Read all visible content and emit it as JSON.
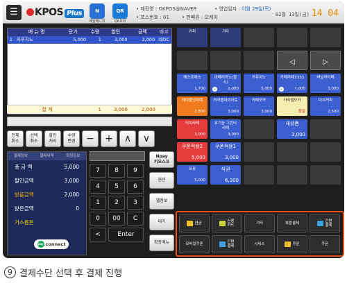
{
  "topbar": {
    "menu_icon": "hamburger-icon",
    "logo_main": "KPOS",
    "logo_plus": "Plus",
    "icon1_label": "배달메니저",
    "icon1_text": "N",
    "icon2_label": "QR오더",
    "icon2_text": "QR",
    "store_label": "• 매장명 : OKPOS@NAVER",
    "pos_label": "• 포스번호 : 01",
    "business_date_label": "• 영업일자 : ",
    "business_date": "이월 29일(목)",
    "cashier_label": "• 판매원 : 오케이",
    "date_label": "02월 13일(금)",
    "time": "14 04"
  },
  "order_table": {
    "headers": [
      "",
      "메 뉴 명",
      "단가",
      "수량",
      "할인",
      "금액",
      "비고"
    ],
    "rows": [
      [
        "1",
        "카푸치노",
        "5,000",
        "1",
        "3,000",
        "2,000",
        "네OC"
      ]
    ],
    "sum_label": "합    계",
    "sum_qty": "1",
    "sum_discount": "3,000",
    "sum_amount": "2,000"
  },
  "action_buttons": [
    {
      "label": "전체\n취소"
    },
    {
      "label": "선택\n취소"
    },
    {
      "label": "할인\n처리"
    },
    {
      "label": "수량\n변경"
    }
  ],
  "arrow_buttons": [
    "−",
    "+",
    "∧",
    "∨"
  ],
  "payment_info": {
    "tabs": [
      "결제정보",
      "결제내역",
      "회원정보"
    ],
    "total_label": "총 금 액",
    "total_value": "5,000",
    "discount_label": "할인금액",
    "discount_value": "3,000",
    "receivable_label": "받을금액",
    "receivable_value": "2,000",
    "received_label": "받은금액",
    "received_value": "0",
    "change_label": "거스름돈",
    "payco_label": "connect",
    "payco_icon": "pay"
  },
  "numpad": {
    "keys": [
      "7",
      "8",
      "9",
      "4",
      "5",
      "6",
      "1",
      "2",
      "3",
      "0",
      "00",
      "C",
      "<",
      "Enter"
    ]
  },
  "side_buttons": [
    "Npay\n키오스크",
    "현관",
    "웹정보",
    "대기",
    "확장메뉴"
  ],
  "items": [
    {
      "label": "커피",
      "style": "navy"
    },
    {
      "label": "기타",
      "style": "navy"
    },
    {
      "label": "",
      "style": "empty"
    },
    {
      "label": "",
      "style": "empty"
    },
    {
      "label": "",
      "style": "empty"
    },
    {
      "label": "",
      "style": "empty"
    },
    {
      "label": "",
      "style": "empty"
    },
    {
      "label": "",
      "style": "empty"
    },
    {
      "label": "◁",
      "style": "nav"
    },
    {
      "label": "▷",
      "style": "nav"
    },
    {
      "label": "에스프레소",
      "price": "1,700",
      "style": "blue"
    },
    {
      "label": "아메리카노(할\n시)",
      "price": "2,000",
      "style": "blue",
      "badge": true
    },
    {
      "label": "카푸치노",
      "price": "5,000",
      "style": "blue"
    },
    {
      "label": "카페라떼3333",
      "price": "7,000",
      "style": "blue",
      "badge": true
    },
    {
      "label": "바닐라라떼",
      "price": "3,000",
      "style": "blue"
    },
    {
      "label": "헤이즐넛라떼",
      "price": "2,800",
      "style": "orange"
    },
    {
      "label": "카라멜마끼아토",
      "price": "3,000",
      "style": "blue"
    },
    {
      "label": "카페모카",
      "price": "3,000",
      "style": "blue"
    },
    {
      "label": "카라멜모카",
      "price": "품절",
      "style": "yellow"
    },
    {
      "label": "더치커피",
      "price": "2,500",
      "style": "blue"
    },
    {
      "label": "더치라떼",
      "price": "3,000",
      "style": "red"
    },
    {
      "label": "유기농 그린티\n라떼",
      "price": "3,000",
      "style": "blue"
    },
    {
      "label": "",
      "style": "empty"
    },
    {
      "label": "새상품",
      "price": "3,000",
      "style": "blue",
      "big": true
    },
    {
      "label": "",
      "style": "empty"
    },
    {
      "label": "쿠폰적용2",
      "price": "5,000",
      "style": "red",
      "big": true
    },
    {
      "label": "쿠폰적용1",
      "price": "3,000",
      "style": "blue",
      "big": true
    },
    {
      "label": "",
      "style": "empty"
    },
    {
      "label": "",
      "style": "empty"
    },
    {
      "label": "",
      "style": "empty"
    },
    {
      "label": "포장",
      "price": "5,000",
      "style": "blue"
    },
    {
      "label": "식권",
      "price": "6,000",
      "style": "blue",
      "big": true
    },
    {
      "label": "",
      "style": "empty"
    },
    {
      "label": "",
      "style": "empty"
    },
    {
      "label": "",
      "style": "empty"
    }
  ],
  "payment_methods": [
    {
      "label": "현금",
      "icon": "cash-icon",
      "color": "#f2c230"
    },
    {
      "label": "신용\n카드",
      "icon": "credit-card-icon",
      "color": "#c9d23a"
    },
    {
      "label": "기타",
      "icon": "",
      "color": ""
    },
    {
      "label": "복합결제",
      "icon": "",
      "color": ""
    },
    {
      "label": "간편\n결제",
      "icon": "mobile-pay-icon",
      "color": "#3aa0e0"
    },
    {
      "label": "모바일쿠폰",
      "icon": "",
      "color": ""
    },
    {
      "label": "간편\n결제",
      "icon": "mobile-pay-icon",
      "color": "#3aa0e0"
    },
    {
      "label": "시네스",
      "icon": "",
      "color": ""
    },
    {
      "label": "주문",
      "icon": "order-icon",
      "color": "#f2c230"
    },
    {
      "label": "쿠폰",
      "icon": "",
      "color": ""
    }
  ],
  "caption": {
    "number": "9",
    "text": "결제수단 선택 후 결제 진행"
  }
}
